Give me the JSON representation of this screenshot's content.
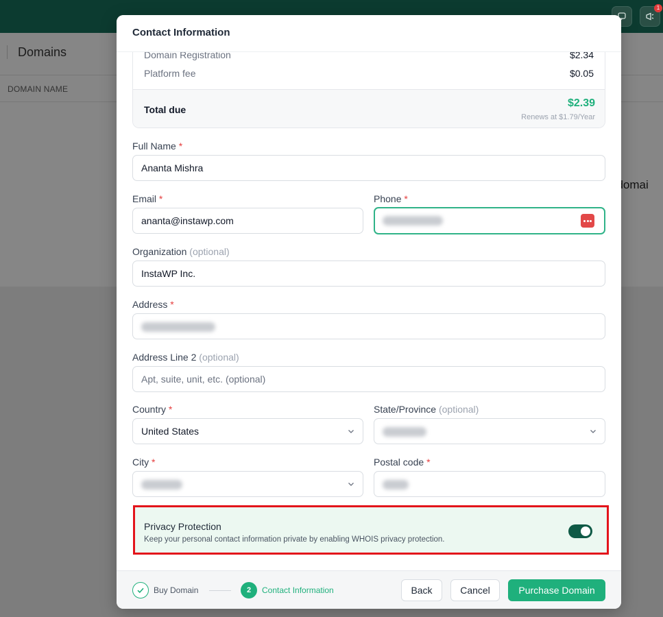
{
  "background": {
    "page_title": "Domains",
    "column_header": "DOMAIN NAME",
    "side_text": "t domai",
    "notification_count": "1"
  },
  "modal": {
    "title": "Contact Information",
    "summary": {
      "rows": [
        {
          "label": "Domain Registration",
          "value": "$2.34"
        },
        {
          "label": "Platform fee",
          "value": "$0.05"
        }
      ],
      "total_label": "Total due",
      "total_amount": "$2.39",
      "renew_note": "Renews at $1.79/Year"
    },
    "fields": {
      "full_name": {
        "label": "Full Name",
        "value": "Ananta Mishra"
      },
      "email": {
        "label": "Email",
        "value": "ananta@instawp.com"
      },
      "phone": {
        "label": "Phone"
      },
      "organization": {
        "label": "Organization",
        "optional": "(optional)",
        "value": "InstaWP Inc."
      },
      "address": {
        "label": "Address"
      },
      "address2": {
        "label": "Address Line 2",
        "optional": "(optional)",
        "placeholder": "Apt, suite, unit, etc. (optional)"
      },
      "country": {
        "label": "Country",
        "value": "United States"
      },
      "state": {
        "label": "State/Province",
        "optional": "(optional)"
      },
      "city": {
        "label": "City"
      },
      "postal": {
        "label": "Postal code"
      }
    },
    "privacy": {
      "title": "Privacy Protection",
      "description": "Keep your personal contact information private by enabling WHOIS privacy protection.",
      "enabled": true
    },
    "steps": [
      {
        "number": "1",
        "label": "Buy Domain"
      },
      {
        "number": "2",
        "label": "Contact Information"
      }
    ],
    "buttons": {
      "back": "Back",
      "cancel": "Cancel",
      "purchase": "Purchase Domain"
    }
  },
  "colors": {
    "accent": "#1fb07c",
    "topbar": "#0c3b30",
    "highlight_border": "#e3141b",
    "toggle_on": "#0f5a46"
  }
}
